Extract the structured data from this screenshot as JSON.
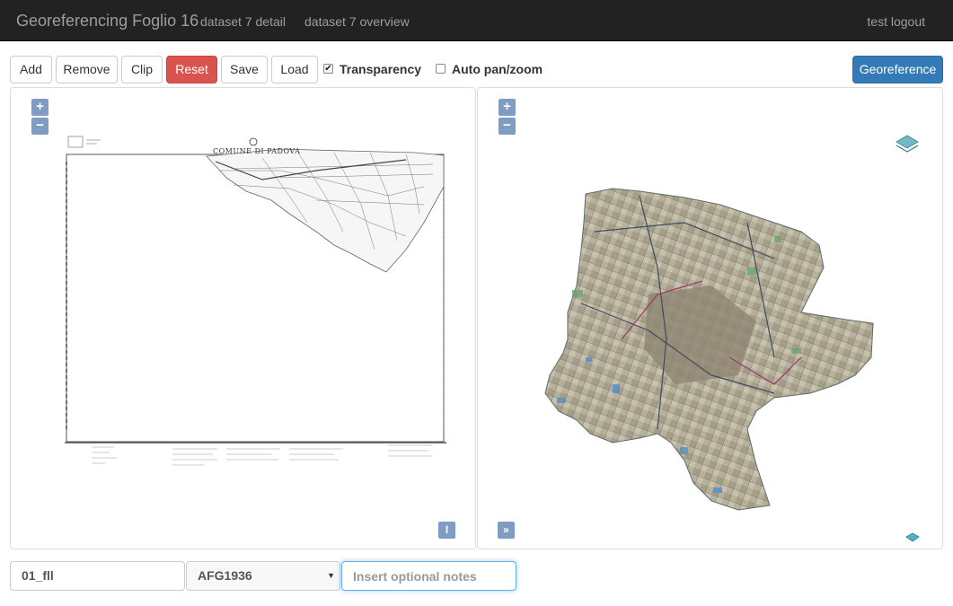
{
  "navbar": {
    "brand": "Georeferencing Foglio 16",
    "links": [
      "dataset 7 detail",
      "dataset 7 overview"
    ],
    "user": "test logout"
  },
  "toolbar": {
    "add": "Add",
    "remove": "Remove",
    "clip": "Clip",
    "reset": "Reset",
    "save": "Save",
    "load": "Load",
    "transparency_label": "Transparency",
    "transparency_checked": true,
    "autopan_label": "Auto pan/zoom",
    "autopan_checked": false,
    "georeference": "Georeference"
  },
  "left_map": {
    "zoom_in": "+",
    "zoom_out": "−",
    "corner_button": "I",
    "sheet_title": "COMUNE DI PADOVA"
  },
  "right_map": {
    "zoom_in": "+",
    "zoom_out": "−",
    "corner_button": "»",
    "layers_icon": "layers-icon"
  },
  "form": {
    "name_value": "01_fll",
    "srs_value": "AFG1936",
    "notes_placeholder": "Insert optional notes"
  },
  "colors": {
    "navbar_bg": "#222222",
    "reset": "#d9534f",
    "georeference": "#337ab7",
    "map_control": "#7f9dc3"
  }
}
